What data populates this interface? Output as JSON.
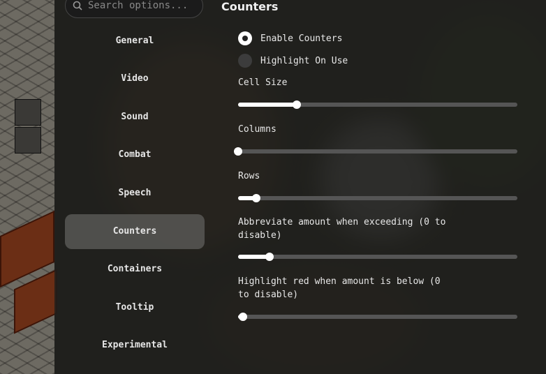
{
  "search": {
    "placeholder": "Search options..."
  },
  "nav": {
    "items": [
      {
        "label": "General",
        "active": false
      },
      {
        "label": "Video",
        "active": false
      },
      {
        "label": "Sound",
        "active": false
      },
      {
        "label": "Combat",
        "active": false
      },
      {
        "label": "Speech",
        "active": false
      },
      {
        "label": "Counters",
        "active": true
      },
      {
        "label": "Containers",
        "active": false
      },
      {
        "label": "Tooltip",
        "active": false
      },
      {
        "label": "Experimental",
        "active": false
      }
    ]
  },
  "content": {
    "title": "Counters",
    "options": {
      "enable_counters": {
        "label": "Enable Counters",
        "checked": true
      },
      "highlight_on_use": {
        "label": "Highlight On Use",
        "checked": false
      }
    },
    "sliders": [
      {
        "label": "Cell Size",
        "fraction": 0.21
      },
      {
        "label": "Columns",
        "fraction": 0.0
      },
      {
        "label": "Rows",
        "fraction": 0.065
      },
      {
        "label": "Abbreviate amount when exceeding (0 to disable)",
        "fraction": 0.113
      },
      {
        "label": "Highlight red when amount is below (0 to disable)",
        "fraction": 0.018
      }
    ]
  },
  "colors": {
    "accent": "#ffffff",
    "track": "#555555",
    "active_nav": "#5f5f5c"
  }
}
